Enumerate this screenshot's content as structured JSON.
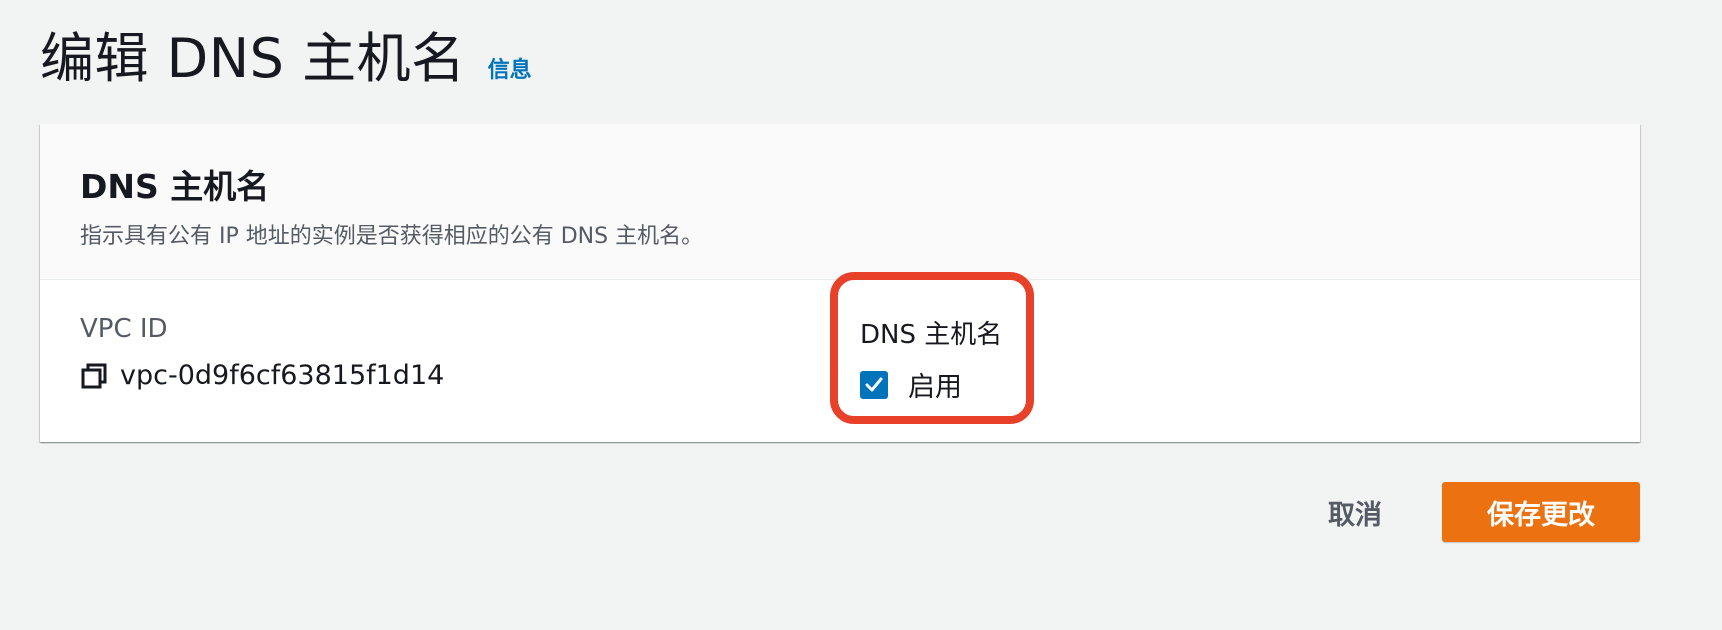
{
  "header": {
    "title": "编辑 DNS 主机名",
    "info_link": "信息"
  },
  "panel": {
    "title": "DNS 主机名",
    "description": "指示具有公有 IP 地址的实例是否获得相应的公有 DNS 主机名。",
    "vpc": {
      "label": "VPC ID",
      "value": "vpc-0d9f6cf63815f1d14",
      "icon": "copy-icon"
    },
    "dns_hostnames": {
      "label": "DNS 主机名",
      "checkbox_label": "启用",
      "checked": true
    }
  },
  "actions": {
    "cancel_label": "取消",
    "save_label": "保存更改"
  },
  "colors": {
    "primary_button": "#ec7211",
    "link": "#0073bb",
    "checkbox": "#0073bb",
    "highlight": "#e8412a",
    "page_background": "#f2f3f3"
  }
}
